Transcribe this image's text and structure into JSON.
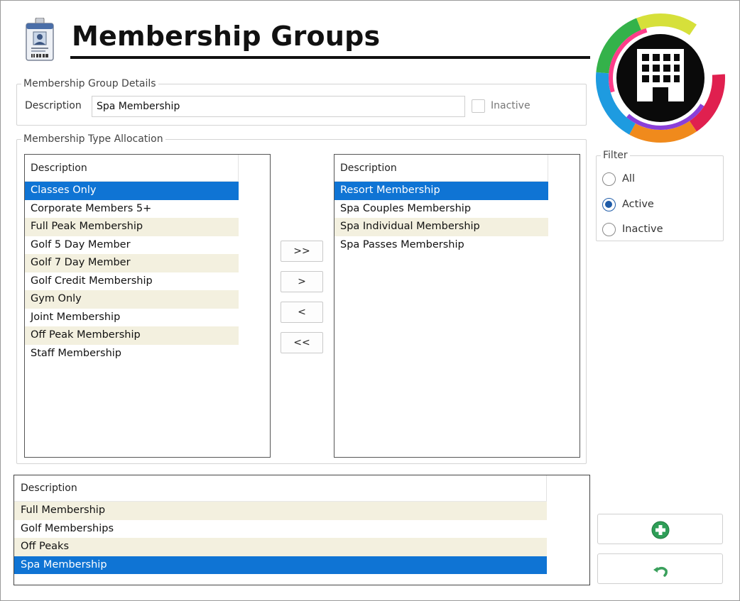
{
  "header": {
    "title": "Membership Groups",
    "app_icon": "id-badge-icon",
    "logo_icon": "building-icon"
  },
  "details": {
    "legend": "Membership Group Details",
    "description_label": "Description",
    "description_value": "Spa Membership",
    "inactive_label": "Inactive",
    "inactive_checked": false
  },
  "allocation": {
    "legend": "Membership Type Allocation",
    "available": {
      "header": "Description",
      "items": [
        "Classes Only",
        "Corporate Members 5+",
        "Full Peak Membership",
        "Golf 5 Day Member",
        "Golf 7 Day Member",
        "Golf Credit Membership",
        "Gym Only",
        "Joint Membership",
        "Off Peak Membership",
        "Staff Membership"
      ],
      "selected": "Classes Only"
    },
    "assigned": {
      "header": "Description",
      "items": [
        "Resort Membership",
        "Spa Couples Membership",
        "Spa Individual Membership",
        "Spa Passes Membership"
      ],
      "selected": "Resort Membership"
    },
    "buttons": {
      "add_all": ">>",
      "add_one": ">",
      "remove_one": "<",
      "remove_all": "<<"
    }
  },
  "filter": {
    "legend": "Filter",
    "options": [
      "All",
      "Active",
      "Inactive"
    ],
    "selected": "Active"
  },
  "groups": {
    "header": "Description",
    "items": [
      "Full Membership",
      "Golf Memberships",
      "Off Peaks",
      "Spa Membership"
    ],
    "selected": "Spa Membership"
  },
  "actions": {
    "add_icon": "plus-circle-icon",
    "undo_icon": "undo-arrow-icon"
  },
  "colors": {
    "selection": "#0f74d4",
    "alt_row": "#f3f0df",
    "add_green": "#2e9e57",
    "undo_green": "#3aa05c"
  }
}
